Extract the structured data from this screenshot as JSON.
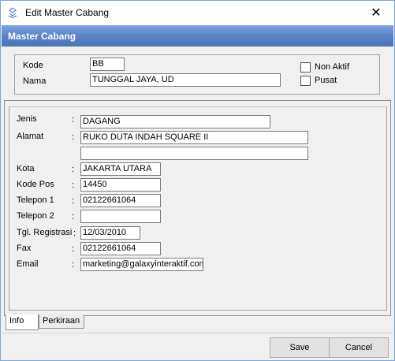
{
  "window": {
    "title": "Edit Master Cabang",
    "close_glyph": "✕"
  },
  "header": {
    "title": "Master  Cabang"
  },
  "top": {
    "kode_label": "Kode",
    "kode_value": "BB",
    "nama_label": "Nama",
    "nama_value": "TUNGGAL JAYA, UD",
    "non_aktif_label": "Non Aktif",
    "pusat_label": "Pusat"
  },
  "form": {
    "colon": ":",
    "fields": [
      {
        "label": "Jenis",
        "value": "DAGANG"
      },
      {
        "label": "Alamat",
        "value": "RUKO  DUTA INDAH SQUARE II",
        "value2": ""
      },
      {
        "label": "Kota",
        "value": "JAKARTA UTARA"
      },
      {
        "label": "Kode Pos",
        "value": "14450"
      },
      {
        "label": "Telepon 1",
        "value": "02122661064"
      },
      {
        "label": "Telepon 2",
        "value": ""
      },
      {
        "label": "Tgl. Registrasi",
        "value": "12/03/2010"
      },
      {
        "label": "Fax",
        "value": "02122661064"
      },
      {
        "label": "Email",
        "value": "marketing@galaxyinteraktif.com"
      }
    ]
  },
  "tabs": [
    {
      "label": "Info",
      "active": true
    },
    {
      "label": "Perkiraan",
      "active": false
    }
  ],
  "buttons": {
    "save": "Save",
    "cancel": "Cancel"
  },
  "colors": {
    "header_bar": "#5d86c9",
    "window_bg": "#f0f0f0"
  },
  "icons": {
    "title": "app-icon",
    "close": "close-icon"
  }
}
